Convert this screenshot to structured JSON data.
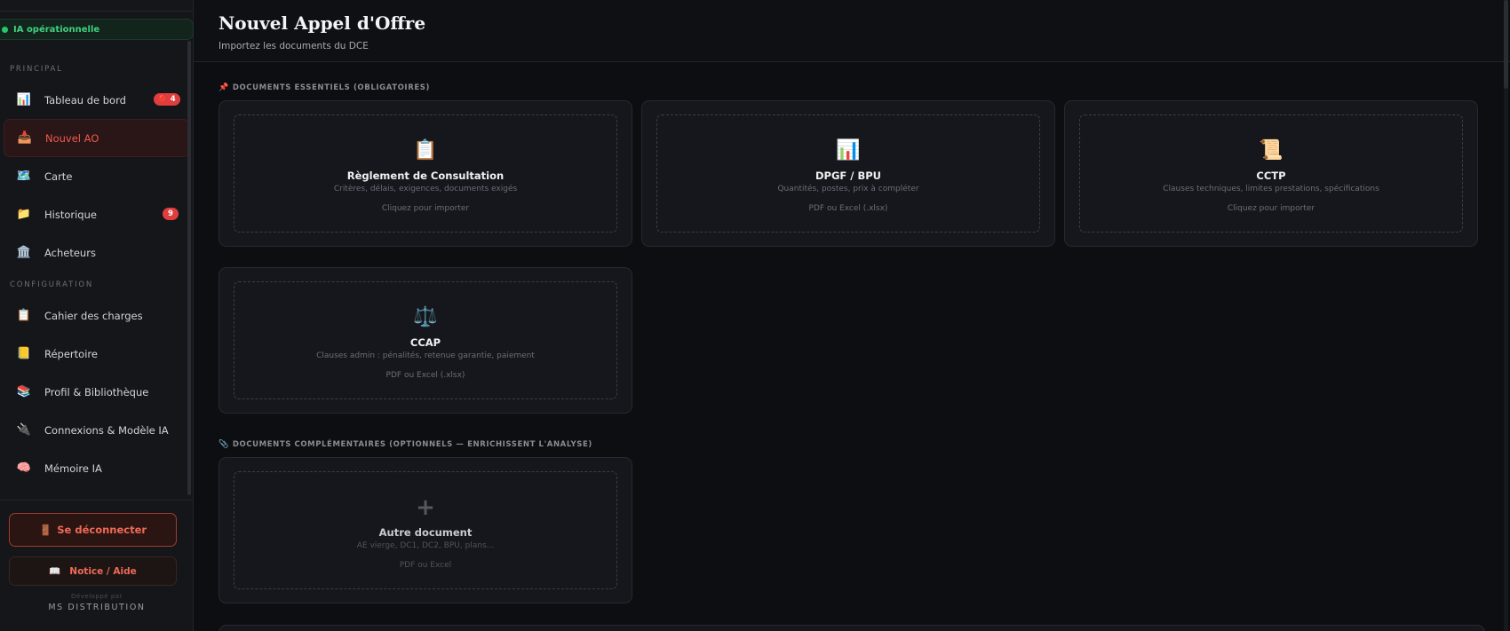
{
  "sidebar": {
    "status": "IA opérationnelle",
    "section_principal": "PRINCIPAL",
    "section_config": "CONFIGURATION",
    "items": [
      {
        "label": "Tableau de bord",
        "icon": "bar-chart-icon",
        "badge": "🔴 4"
      },
      {
        "label": "Nouvel AO",
        "icon": "inbox-tray-icon",
        "active": true
      },
      {
        "label": "Carte",
        "icon": "map-icon"
      },
      {
        "label": "Historique",
        "icon": "folder-icon",
        "badge": "9"
      },
      {
        "label": "Acheteurs",
        "icon": "bank-icon"
      },
      {
        "label": "Cahier des charges",
        "icon": "clipboard-icon"
      },
      {
        "label": "Répertoire",
        "icon": "notebook-icon"
      },
      {
        "label": "Profil & Bibliothèque",
        "icon": "books-icon"
      },
      {
        "label": "Connexions & Modèle IA",
        "icon": "plug-icon"
      },
      {
        "label": "Mémoire IA",
        "icon": "brain-icon"
      }
    ],
    "logout_label": "Se déconnecter",
    "help_label": "Notice / Aide",
    "developed_by": "Développé par",
    "company": "MS DISTRIBUTION"
  },
  "header": {
    "title": "Nouvel Appel d'Offre",
    "subtitle": "Importez les documents du DCE"
  },
  "essentials": {
    "title": "DOCUMENTS ESSENTIELS (OBLIGATOIRES)",
    "cards": [
      {
        "title": "Règlement de Consultation",
        "desc": "Critères, délais, exigences, documents exigés",
        "hint": "Cliquez pour importer",
        "icon": "clipboard-icon"
      },
      {
        "title": "DPGF / BPU",
        "desc": "Quantités, postes, prix à compléter",
        "hint": "PDF ou Excel (.xlsx)",
        "icon": "bar-chart-icon"
      },
      {
        "title": "CCTP",
        "desc": "Clauses techniques, limites prestations, spécifications",
        "hint": "Cliquez pour importer",
        "icon": "scroll-icon"
      },
      {
        "title": "CCAP",
        "desc": "Clauses admin : pénalités, retenue garantie, paiement",
        "hint": "PDF ou Excel (.xlsx)",
        "icon": "scales-icon"
      }
    ]
  },
  "complementary": {
    "title": "DOCUMENTS COMPLÉMENTAIRES (OPTIONNELS — ENRICHISSENT L'ANALYSE)",
    "card": {
      "title": "Autre document",
      "desc": "AE vierge, DC1, DC2, BPU, plans...",
      "hint": "PDF ou Excel",
      "icon": "plus-icon"
    }
  }
}
